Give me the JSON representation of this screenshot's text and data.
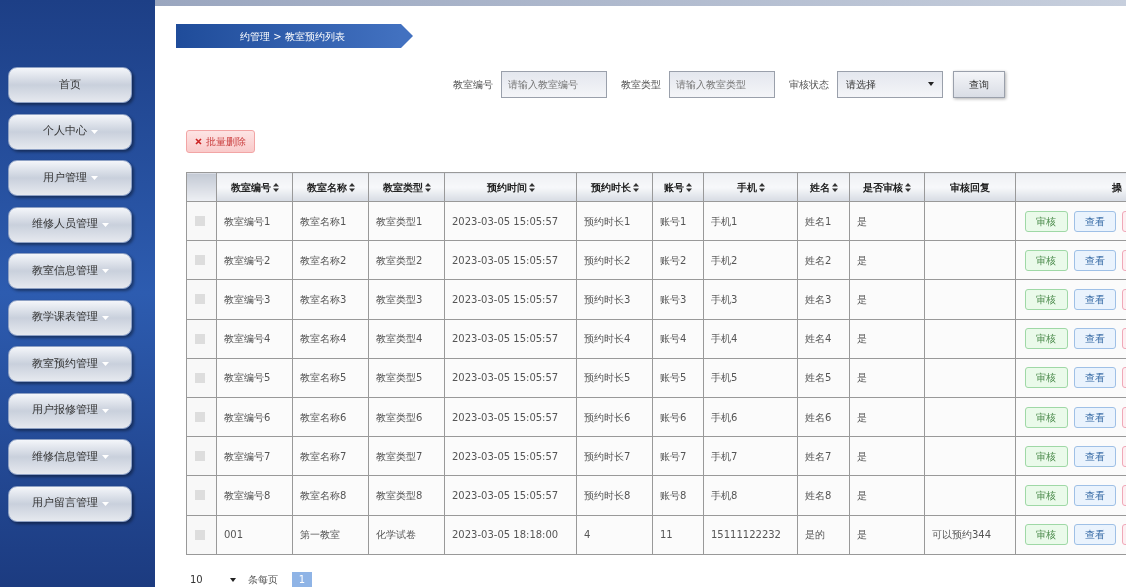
{
  "sidebar": {
    "items": [
      {
        "label": "首页",
        "has_menu": false
      },
      {
        "label": "个人中心",
        "has_menu": true
      },
      {
        "label": "用户管理",
        "has_menu": true
      },
      {
        "label": "维修人员管理",
        "has_menu": true
      },
      {
        "label": "教室信息管理",
        "has_menu": true
      },
      {
        "label": "教学课表管理",
        "has_menu": true
      },
      {
        "label": "教室预约管理",
        "has_menu": true
      },
      {
        "label": "用户报修管理",
        "has_menu": true
      },
      {
        "label": "维修信息管理",
        "has_menu": true
      },
      {
        "label": "用户留言管理",
        "has_menu": true
      }
    ]
  },
  "breadcrumb": "约管理 > 教室预约列表",
  "search": {
    "fields": [
      {
        "kind": "input",
        "label": "教室编号",
        "placeholder": "请输入教室编号"
      },
      {
        "kind": "input",
        "label": "教室类型",
        "placeholder": "请输入教室类型"
      },
      {
        "kind": "select",
        "label": "审核状态",
        "value": "请选择"
      }
    ],
    "button": "查询"
  },
  "batch_delete": "批量删除",
  "table": {
    "columns": [
      {
        "label": "教室编号",
        "sortable": true
      },
      {
        "label": "教室名称",
        "sortable": true
      },
      {
        "label": "教室类型",
        "sortable": true
      },
      {
        "label": "预约时间",
        "sortable": true
      },
      {
        "label": "预约时长",
        "sortable": true
      },
      {
        "label": "账号",
        "sortable": true
      },
      {
        "label": "手机",
        "sortable": true
      },
      {
        "label": "姓名",
        "sortable": true
      },
      {
        "label": "是否审核",
        "sortable": true
      },
      {
        "label": "审核回复",
        "sortable": false
      },
      {
        "label": "操",
        "sortable": false
      }
    ],
    "rows": [
      {
        "checked": false,
        "cells": [
          "教室编号1",
          "教室名称1",
          "教室类型1",
          "2023-03-05 15:05:57",
          "预约时长1",
          "账号1",
          "手机1",
          "姓名1",
          "是",
          ""
        ],
        "actions": [
          "审核",
          "查看"
        ]
      },
      {
        "checked": false,
        "cells": [
          "教室编号2",
          "教室名称2",
          "教室类型2",
          "2023-03-05 15:05:57",
          "预约时长2",
          "账号2",
          "手机2",
          "姓名2",
          "是",
          ""
        ],
        "actions": [
          "审核",
          "查看"
        ]
      },
      {
        "checked": false,
        "cells": [
          "教室编号3",
          "教室名称3",
          "教室类型3",
          "2023-03-05 15:05:57",
          "预约时长3",
          "账号3",
          "手机3",
          "姓名3",
          "是",
          ""
        ],
        "actions": [
          "审核",
          "查看"
        ]
      },
      {
        "checked": false,
        "cells": [
          "教室编号4",
          "教室名称4",
          "教室类型4",
          "2023-03-05 15:05:57",
          "预约时长4",
          "账号4",
          "手机4",
          "姓名4",
          "是",
          ""
        ],
        "actions": [
          "审核",
          "查看"
        ]
      },
      {
        "checked": false,
        "cells": [
          "教室编号5",
          "教室名称5",
          "教室类型5",
          "2023-03-05 15:05:57",
          "预约时长5",
          "账号5",
          "手机5",
          "姓名5",
          "是",
          ""
        ],
        "actions": [
          "审核",
          "查看"
        ]
      },
      {
        "checked": false,
        "cells": [
          "教室编号6",
          "教室名称6",
          "教室类型6",
          "2023-03-05 15:05:57",
          "预约时长6",
          "账号6",
          "手机6",
          "姓名6",
          "是",
          ""
        ],
        "actions": [
          "审核",
          "查看"
        ]
      },
      {
        "checked": false,
        "cells": [
          "教室编号7",
          "教室名称7",
          "教室类型7",
          "2023-03-05 15:05:57",
          "预约时长7",
          "账号7",
          "手机7",
          "姓名7",
          "是",
          ""
        ],
        "actions": [
          "审核",
          "查看"
        ]
      },
      {
        "checked": false,
        "cells": [
          "教室编号8",
          "教室名称8",
          "教室类型8",
          "2023-03-05 15:05:57",
          "预约时长8",
          "账号8",
          "手机8",
          "姓名8",
          "是",
          ""
        ],
        "actions": [
          "审核",
          "查看"
        ]
      },
      {
        "checked": false,
        "cells": [
          "001",
          "第一教室",
          "化学试卷",
          "2023-03-05 18:18:00",
          "4",
          "11",
          "15111122232",
          "是的",
          "是",
          "可以预约344"
        ],
        "actions": [
          "审核",
          "查看"
        ]
      }
    ]
  },
  "pagination": {
    "page_size": "10",
    "per_page_label": "条每页",
    "pages": [
      {
        "label": "1",
        "selected": true
      }
    ]
  }
}
